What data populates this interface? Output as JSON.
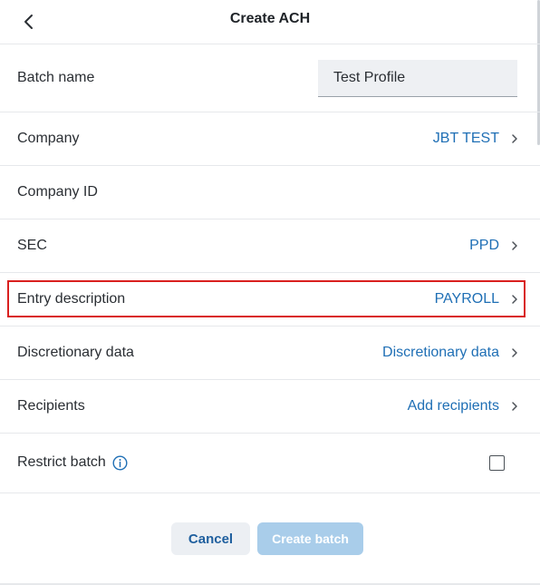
{
  "header": {
    "title": "Create ACH",
    "back_icon": "chevron-left-icon"
  },
  "form": {
    "batch_name": {
      "label": "Batch name",
      "value": "Test Profile"
    },
    "company": {
      "label": "Company",
      "value": "JBT TEST"
    },
    "company_id": {
      "label": "Company ID",
      "value": ""
    },
    "sec": {
      "label": "SEC",
      "value": "PPD"
    },
    "entry_description": {
      "label": "Entry description",
      "value": "PAYROLL",
      "highlighted": true
    },
    "discretionary_data": {
      "label": "Discretionary data",
      "value": "Discretionary data"
    },
    "recipients": {
      "label": "Recipients",
      "value": "Add recipients"
    },
    "restrict_batch": {
      "label": "Restrict batch",
      "checked": false,
      "icon": "info-icon"
    }
  },
  "actions": {
    "cancel_label": "Cancel",
    "create_label": "Create batch"
  },
  "colors": {
    "link_blue": "#1f6fb5",
    "highlight_red": "#d9201f",
    "create_disabled": "#a9cdea"
  }
}
